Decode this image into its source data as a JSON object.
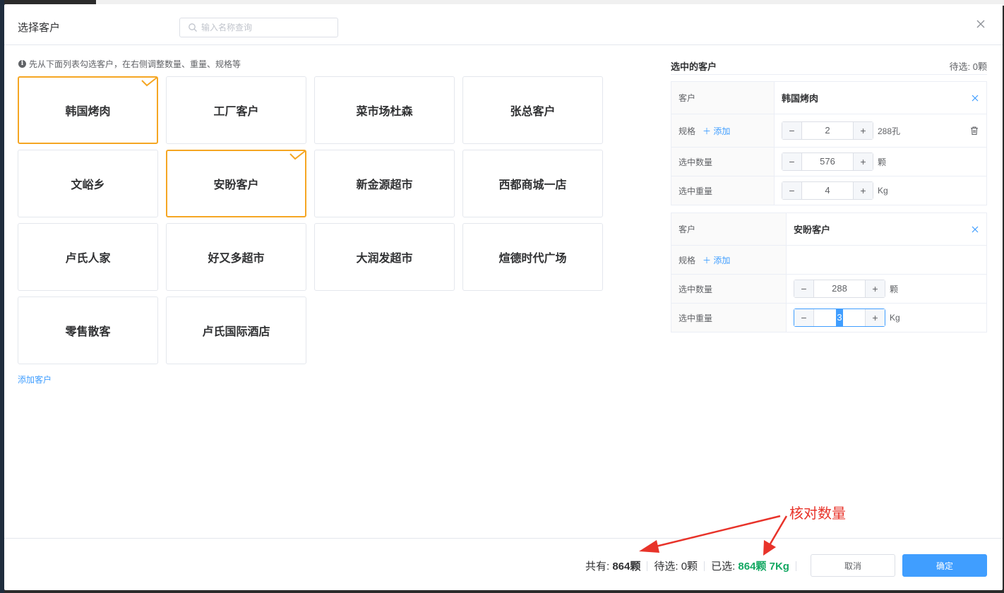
{
  "dialog": {
    "title": "选择客户",
    "search_placeholder": "输入名称查询",
    "hint": "先从下面列表勾选客户，在右侧调整数量、重量、规格等",
    "add_customer": "添加客户"
  },
  "customers": [
    {
      "name": "韩国烤肉",
      "selected": true
    },
    {
      "name": "工厂客户",
      "selected": false
    },
    {
      "name": "菜市场杜森",
      "selected": false
    },
    {
      "name": "张总客户",
      "selected": false
    },
    {
      "name": "文峪乡",
      "selected": false
    },
    {
      "name": "安盼客户",
      "selected": true
    },
    {
      "name": "新金源超市",
      "selected": false
    },
    {
      "name": "西都商城一店",
      "selected": false
    },
    {
      "name": "卢氏人家",
      "selected": false
    },
    {
      "name": "好又多超市",
      "selected": false
    },
    {
      "name": "大润发超市",
      "selected": false
    },
    {
      "name": "煊德时代广场",
      "selected": false
    },
    {
      "name": "零售散客",
      "selected": false
    },
    {
      "name": "卢氏国际酒店",
      "selected": false
    }
  ],
  "selected_panel": {
    "title": "选中的客户",
    "pending": "待选: 0颗",
    "labels": {
      "customer": "客户",
      "spec": "规格",
      "add": "添加",
      "qty": "选中数量",
      "weight": "选中重量"
    },
    "entries": [
      {
        "customer": "韩国烤肉",
        "spec_value": "2",
        "spec_unit": "288孔",
        "qty": "576",
        "qty_unit": "颗",
        "weight": "4",
        "weight_unit": "Kg"
      },
      {
        "customer": "安盼客户",
        "qty": "288",
        "qty_unit": "颗",
        "weight": "3",
        "weight_unit": "Kg"
      }
    ]
  },
  "footer": {
    "total_label": "共有:",
    "total_value": "864颗",
    "pending_label": "待选:",
    "pending_value": "0颗",
    "selected_label": "已选:",
    "selected_value": "864颗 7Kg",
    "cancel": "取消",
    "ok": "确定"
  },
  "annotation": {
    "text": "核对数量",
    "color": "#e8332a"
  },
  "colors": {
    "primary": "#409eff",
    "selected_border": "#f5a623",
    "success": "#13a862"
  }
}
